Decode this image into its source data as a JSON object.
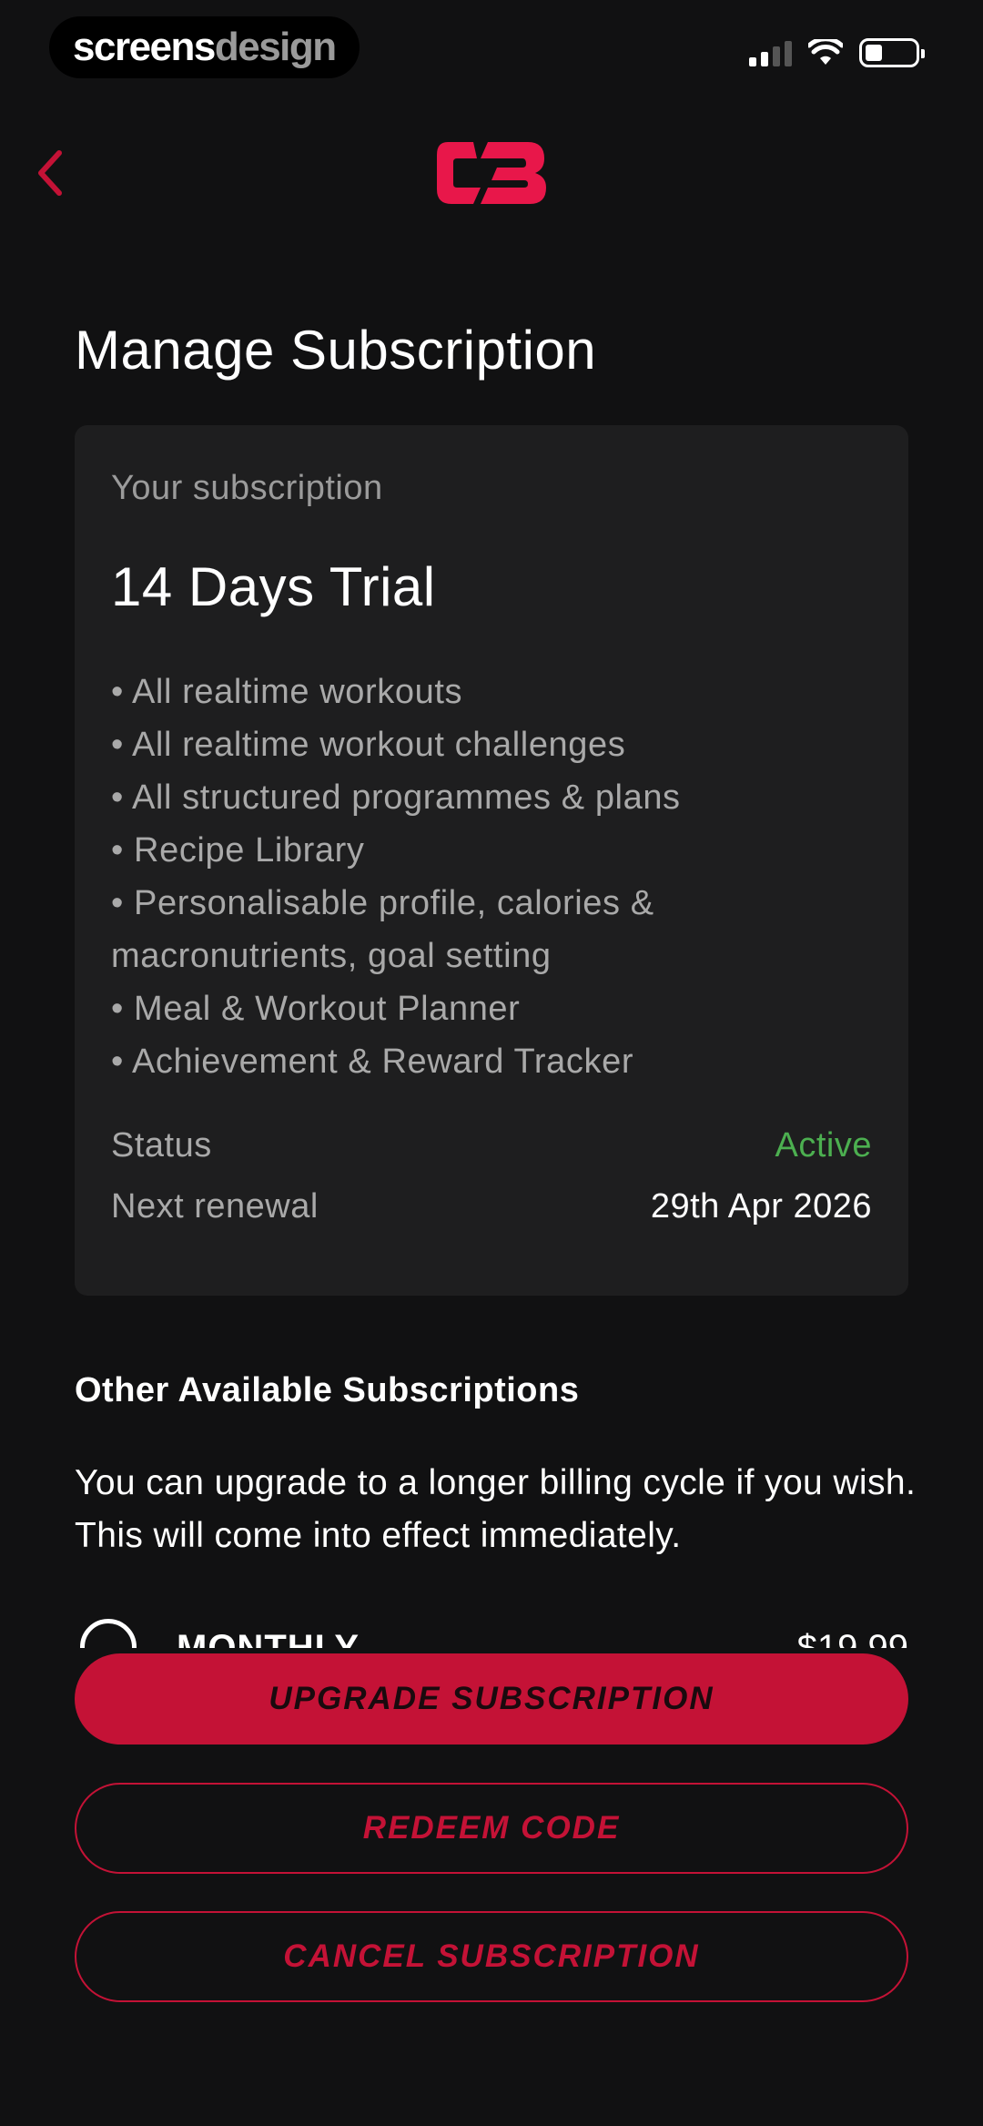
{
  "status_bar": {
    "watermark_part1": "screens",
    "watermark_part2": "design"
  },
  "header": {
    "back_icon": "chevron-left-icon",
    "logo_icon": "cb-logo-icon"
  },
  "page_title": "Manage Subscription",
  "subscription_card": {
    "label": "Your subscription",
    "plan_name": "14 Days Trial",
    "features": [
      "• All realtime workouts",
      "• All realtime workout challenges",
      "• All structured programmes & plans",
      "• Recipe Library",
      "• Personalisable profile, calories & macronutrients, goal setting",
      "• Meal & Workout Planner",
      "• Achievement & Reward Tracker"
    ],
    "status_label": "Status",
    "status_value": "Active",
    "renewal_label": "Next renewal",
    "renewal_value": "29th Apr 2026"
  },
  "other_subscriptions": {
    "title": "Other Available Subscriptions",
    "description": "You can upgrade to a longer billing cycle if you wish. This will come into effect immediately.",
    "options": [
      {
        "label": "MONTHLY",
        "price": "$19.99"
      }
    ]
  },
  "buttons": {
    "upgrade": "UPGRADE SUBSCRIPTION",
    "redeem": "REDEEM CODE",
    "cancel": "CANCEL SUBSCRIPTION"
  },
  "colors": {
    "accent": "#c41236",
    "background": "#111112",
    "card": "#1e1e1f",
    "active": "#4caf50"
  }
}
